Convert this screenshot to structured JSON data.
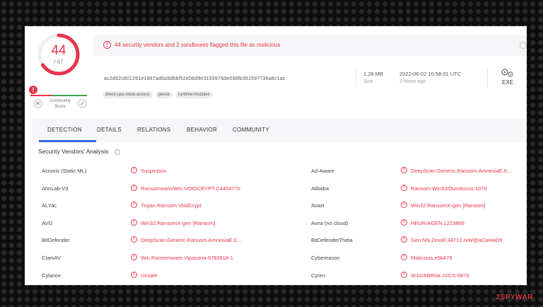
{
  "score": {
    "detections": "44",
    "total": "/ 67",
    "community_label": "Community Score"
  },
  "banner": {
    "text": "44 security vendors and 2 sandboxes flagged this file as malicious"
  },
  "file": {
    "hash": "ac2d92c801261e1887ad6a9dbbf52e08d9e3193976de098fb361597736a8c1ac",
    "tags": [
      "direct-cpu-clock-access",
      "peexe",
      "runtime-modules"
    ],
    "size_value": "1.28 MB",
    "size_label": "Size",
    "date_value": "2022-06-02 10:58:31 UTC",
    "date_relative": "3 hours ago",
    "type_label": "EXE"
  },
  "tabs": [
    "DETECTION",
    "DETAILS",
    "RELATIONS",
    "BEHAVIOR",
    "COMMUNITY"
  ],
  "section_title": "Security Vendors' Analysis",
  "rows": [
    {
      "left_vendor": "Acronis (Static ML)",
      "left_result": "Suspicious",
      "right_vendor": "Ad-Aware",
      "right_result": "DeepScan:Generic.Ransom.AmnesiaE.6..."
    },
    {
      "left_vendor": "AhnLab-V3",
      "left_result": "Ransomware/Win.VOIDCRYPT.C4454770",
      "right_vendor": "Alibaba",
      "right_result": "Ransom:Win32/Ouroboros.1079"
    },
    {
      "left_vendor": "ALYac",
      "left_result": "Trojan.Ransom.VoidCrypt",
      "right_vendor": "Avast",
      "right_result": "Win32:RansomX-gen [Ransom]"
    },
    {
      "left_vendor": "AVG",
      "left_result": "Win32:RansomX-gen [Ransom]",
      "right_vendor": "Avira (no cloud)",
      "right_result": "HEUR/AGEN.1223866"
    },
    {
      "left_vendor": "BitDefender",
      "left_result": "DeepScan:Generic.Ransom.AmnesiaE.6...",
      "right_vendor": "BitDefenderTheta",
      "right_result": "Gen:NN.ZexaF.34712.rxW@aCaHwDfi"
    },
    {
      "left_vendor": "ClamAV",
      "left_result": "Win.Ransomware.Vipasana-9783618-1",
      "right_vendor": "Cybereason",
      "right_result": "Malicious.e5b478"
    },
    {
      "left_vendor": "Cylance",
      "left_result": "Unsafe",
      "right_vendor": "Cyren",
      "right_result": "W32/ABRisk.JVCS-5876"
    }
  ],
  "watermark": "2SPYWAR",
  "colors": {
    "accent_red": "#e8344e",
    "tab_blue": "#2d6cdf"
  }
}
